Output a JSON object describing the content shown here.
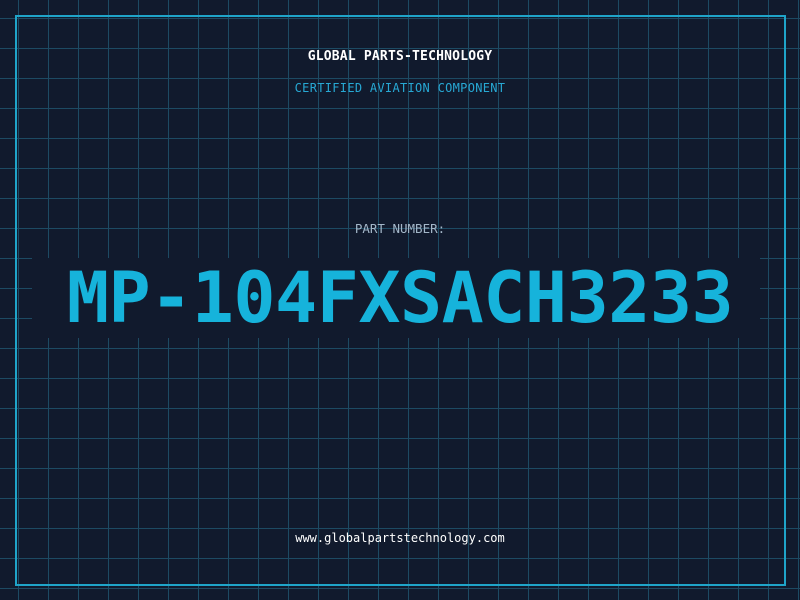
{
  "brand": {
    "name": "GLOBAL PARTS-TECHNOLOGY",
    "subtitle": "CERTIFIED AVIATION COMPONENT"
  },
  "part": {
    "label": "PART NUMBER:",
    "number": "MP-104FXSACH3233"
  },
  "footer": {
    "url": "www.globalpartstechnology.com"
  },
  "colors": {
    "background": "#111a2d",
    "grid": "#1d4a63",
    "accent": "#16b3db",
    "frame": "#1fa4c9"
  }
}
